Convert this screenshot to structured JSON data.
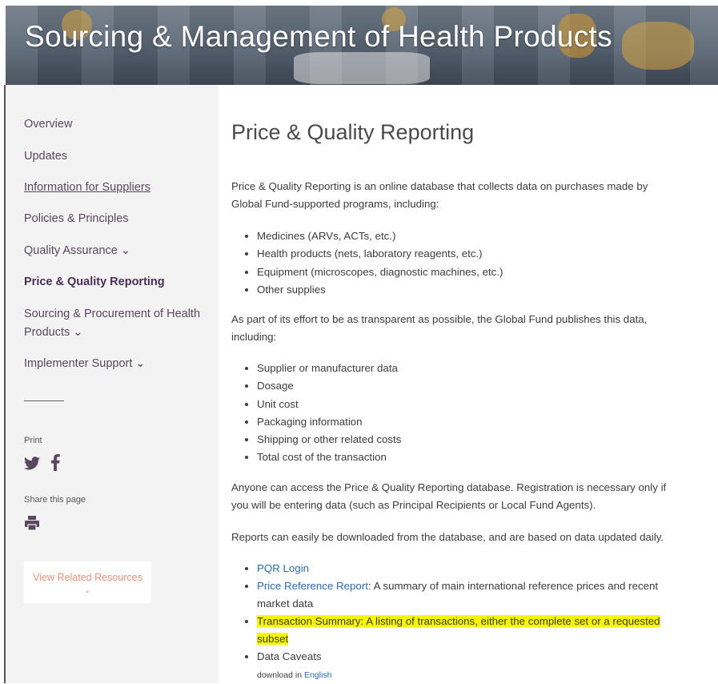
{
  "banner": {
    "title": "Sourcing & Management of Health Products"
  },
  "sidebar": {
    "items": [
      {
        "label": "Overview"
      },
      {
        "label": "Updates"
      },
      {
        "label": "Information for Suppliers"
      },
      {
        "label": "Policies & Principles"
      },
      {
        "label": "Quality Assurance ⌄"
      },
      {
        "label": "Price & Quality Reporting"
      },
      {
        "label_line1": "Sourcing & Procurement of Health",
        "label_line2": "Products ⌄"
      },
      {
        "label": "Implementer Support ⌄"
      }
    ],
    "print_label": "Print",
    "share_label": "Share this page",
    "related_label": "View Related Resources",
    "related_chevron": "⌄"
  },
  "icons": {
    "twitter": "twitter-icon",
    "facebook": "facebook-icon",
    "print": "printer-icon"
  },
  "main": {
    "title": "Price & Quality Reporting",
    "intro": "Price & Quality Reporting is an online database that collects data on purchases made by Global Fund-supported programs, including:",
    "list1": [
      "Medicines (ARVs, ACTs, etc.)",
      "Health products (nets, laboratory reagents, etc.)",
      "Equipment (microscopes, diagnostic machines, etc.)",
      "Other supplies"
    ],
    "para2": "As part of its effort to be as transparent as possible, the Global Fund publishes this data, including:",
    "list2": [
      "Supplier or manufacturer data",
      "Dosage",
      "Unit cost",
      "Packaging information",
      "Shipping or other related costs",
      "Total cost of the transaction"
    ],
    "para3": "Anyone can access the Price & Quality Reporting database. Registration is necessary only if you will be entering data (such as Principal Recipients or Local Fund Agents).",
    "para4": "Reports can easily be downloaded from the database, and are based on data updated daily.",
    "resources": {
      "pqr_login": "PQR Login",
      "price_ref_link": "Price Reference Report",
      "price_ref_desc": ": A summary of main international reference prices and recent market data",
      "transaction_summary": "Transaction Summary: A listing of transactions, either the complete set or a requested subset",
      "data_caveats": "Data Caveats",
      "download_in": "download in ",
      "download_lang": "English"
    }
  },
  "colors": {
    "highlight": "#f7f700",
    "link": "#2b6cb0",
    "nav": "#5a4660",
    "accent": "#e8917a"
  }
}
